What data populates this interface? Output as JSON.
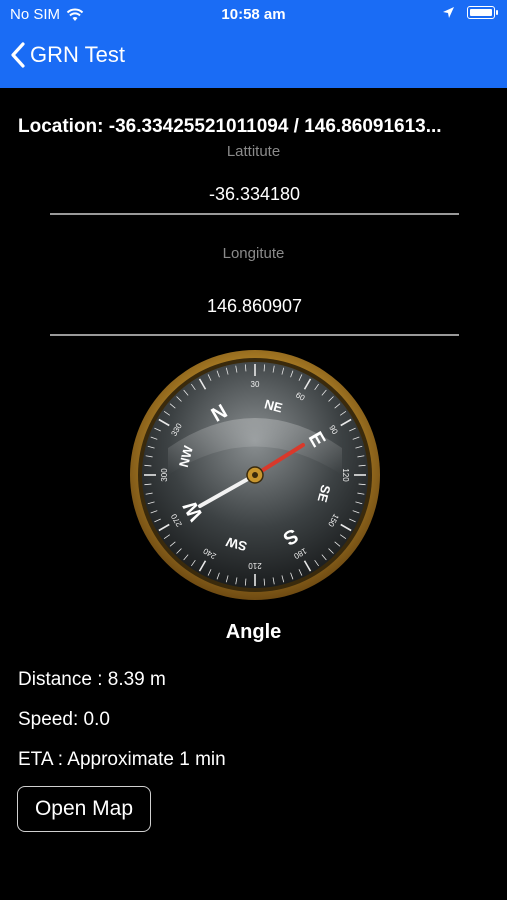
{
  "status_bar": {
    "carrier": "No SIM",
    "time": "10:58 am",
    "wifi_icon": "wifi-icon",
    "location_icon": "location-arrow-icon",
    "battery_icon": "battery-icon"
  },
  "nav": {
    "back_label": "GRN Test",
    "back_icon": "chevron-left-icon",
    "bar_color": "#1a6cf5"
  },
  "location": {
    "text": "Location: -36.33425521011094 / 146.86091613..."
  },
  "latitude": {
    "label": "Lattitute",
    "value": "-36.334180"
  },
  "longitude": {
    "label": "Longitute",
    "value": "146.860907"
  },
  "compass": {
    "cardinals": [
      "N",
      "NE",
      "E",
      "SE",
      "S",
      "SW",
      "W",
      "NW"
    ],
    "degree_labels": [
      "30",
      "60",
      "90",
      "120",
      "150",
      "180",
      "210",
      "240",
      "270",
      "300",
      "330"
    ],
    "ring_color": "#c8962e"
  },
  "angle_title": "Angle",
  "distance": "Distance : 8.39 m",
  "speed": "Speed: 0.0",
  "eta": "ETA : Approximate 1 min",
  "open_map_label": "Open Map"
}
